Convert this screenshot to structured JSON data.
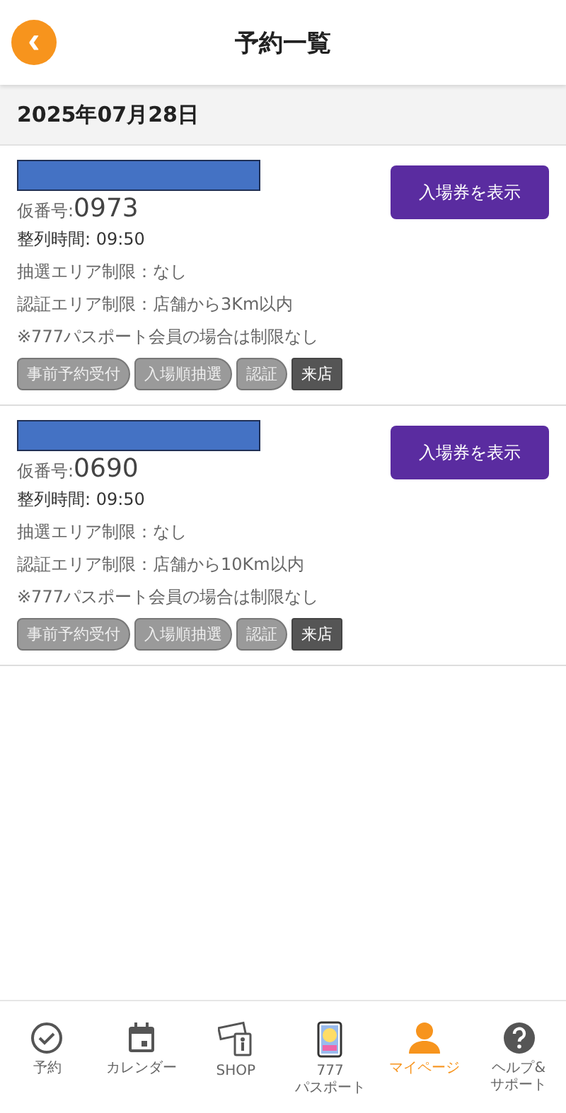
{
  "header": {
    "title": "予約一覧",
    "back_icon": "‹"
  },
  "date": "2025年07月28日",
  "reservations": [
    {
      "redacted": true,
      "number_label": "仮番号:",
      "number": "0973",
      "time": "整列時間: 09:50",
      "lines": [
        "抽選エリア制限：なし",
        "認証エリア制限：店舗から3Km以内",
        "※777パスポート会員の場合は制限なし"
      ],
      "button": "入場券を表示",
      "steps": [
        {
          "label": "事前予約受付",
          "selected": false
        },
        {
          "label": "入場順抽選",
          "selected": false
        },
        {
          "label": "認証",
          "selected": false
        },
        {
          "label": "来店",
          "selected": true
        }
      ]
    },
    {
      "redacted": true,
      "number_label": "仮番号:",
      "number": "0690",
      "time": "整列時間: 09:50",
      "lines": [
        "抽選エリア制限：なし",
        "認証エリア制限：店舗から10Km以内",
        "※777パスポート会員の場合は制限なし"
      ],
      "button": "入場券を表示",
      "steps": [
        {
          "label": "事前予約受付",
          "selected": false
        },
        {
          "label": "入場順抽選",
          "selected": false
        },
        {
          "label": "認証",
          "selected": false
        },
        {
          "label": "来店",
          "selected": true
        }
      ]
    }
  ],
  "nav": [
    {
      "kind": "check",
      "label": "予約",
      "selected": false
    },
    {
      "kind": "calendar",
      "label": "カレンダー",
      "selected": false
    },
    {
      "kind": "shop",
      "label": "SHOP",
      "selected": false
    },
    {
      "kind": "passport",
      "label": "777\nパスポート",
      "selected": false
    },
    {
      "kind": "person",
      "label": "マイページ",
      "selected": true
    },
    {
      "kind": "help",
      "label": "ヘルプ&\nサポート",
      "selected": false
    }
  ]
}
